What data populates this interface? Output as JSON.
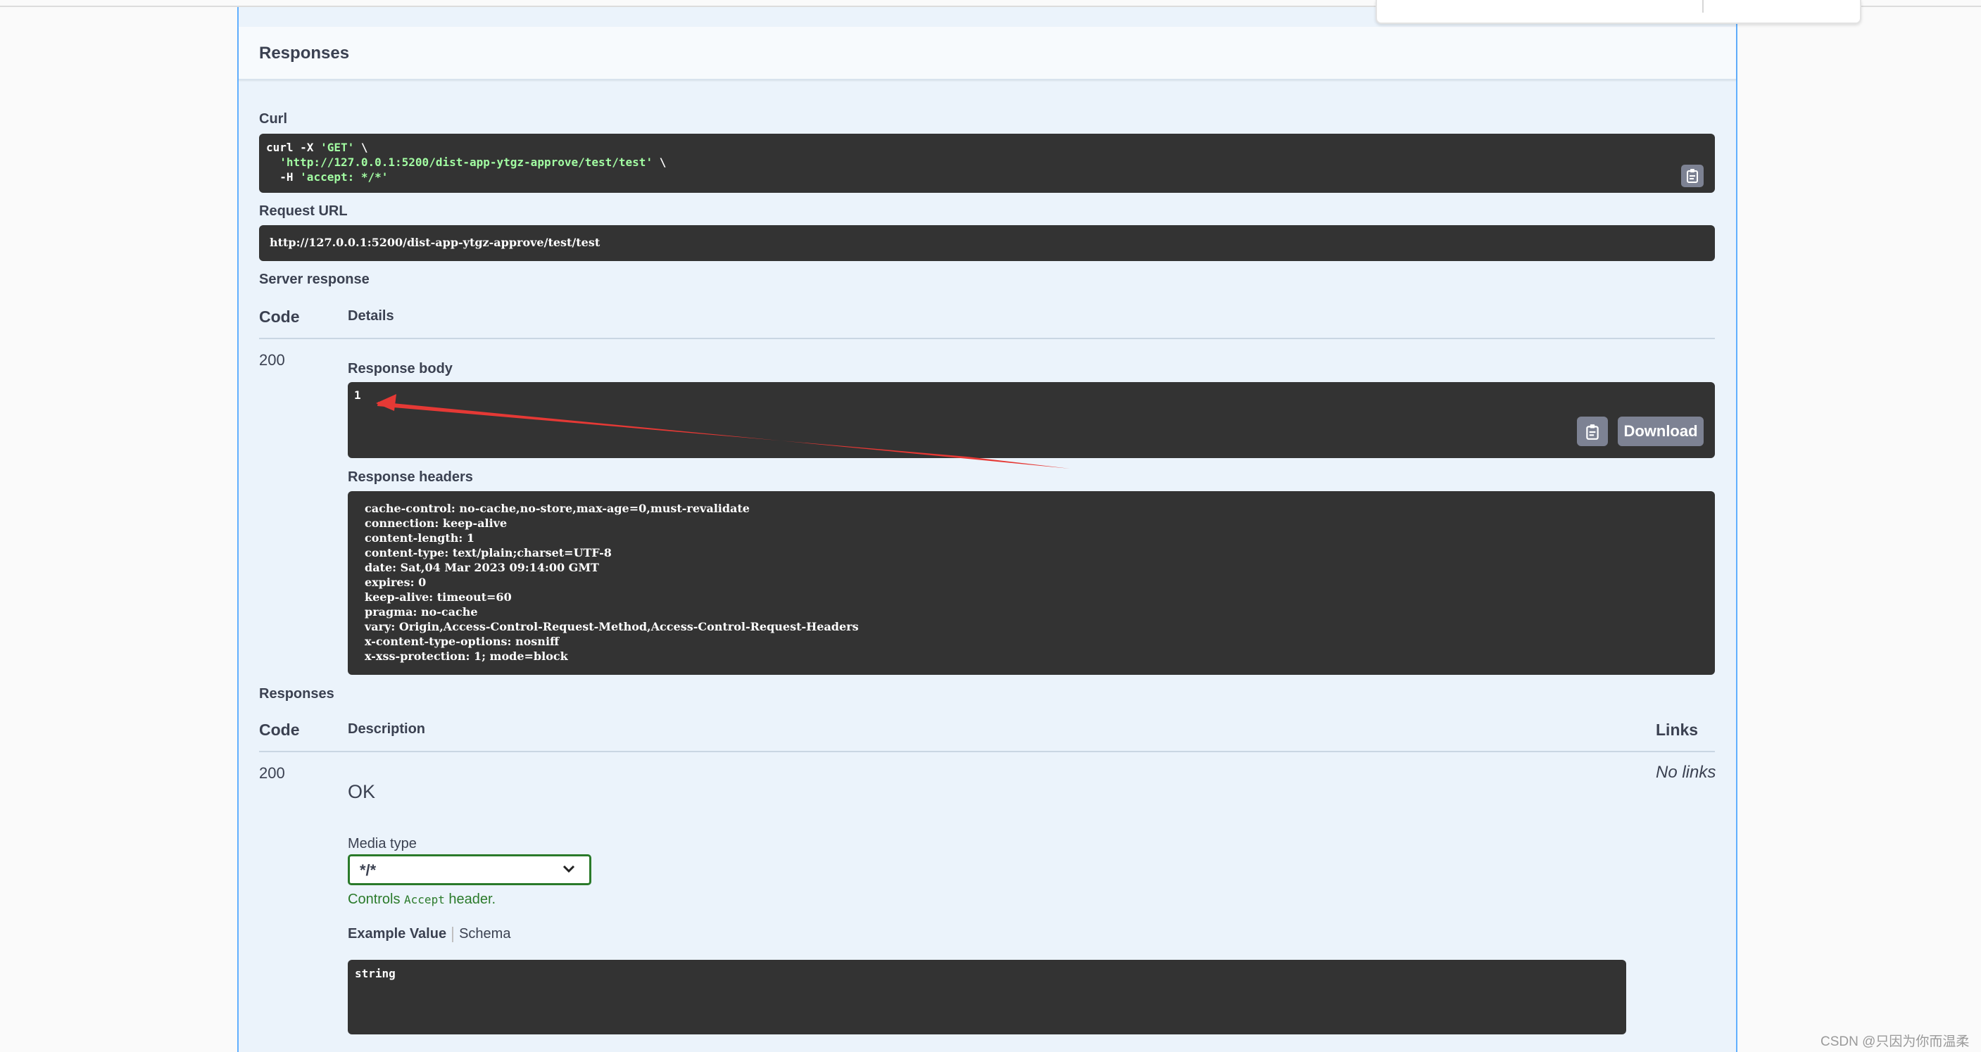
{
  "responses_header": "Responses",
  "curl": {
    "label": "Curl",
    "line1_cmd": "curl -X ",
    "line1_str": "'GET'",
    "line1_tail": " \\",
    "line2_str": "'http://127.0.0.1:5200/dist-app-ytgz-approve/test/test'",
    "line2_tail": " \\",
    "line3_cmd": "  -H ",
    "line3_str": "'accept: */*'"
  },
  "request_url": {
    "label": "Request URL",
    "value": "http://127.0.0.1:5200/dist-app-ytgz-approve/test/test"
  },
  "server_response": {
    "label": "Server response",
    "col_code": "Code",
    "col_details": "Details",
    "code": "200",
    "body_label": "Response body",
    "body": "1",
    "download_label": "Download",
    "headers_label": "Response headers",
    "headers": [
      "cache-control: no-cache,no-store,max-age=0,must-revalidate",
      "connection: keep-alive",
      "content-length: 1",
      "content-type: text/plain;charset=UTF-8",
      "date: Sat,04 Mar 2023 09:14:00 GMT",
      "expires: 0",
      "keep-alive: timeout=60",
      "pragma: no-cache",
      "vary: Origin,Access-Control-Request-Method,Access-Control-Request-Headers",
      "x-content-type-options: nosniff",
      "x-xss-protection: 1; mode=block"
    ]
  },
  "responses": {
    "label": "Responses",
    "col_code": "Code",
    "col_description": "Description",
    "col_links": "Links",
    "code": "200",
    "description": "OK",
    "links": "No links",
    "media_type_label": "Media type",
    "media_type_value": "*/*",
    "controls_prefix": "Controls ",
    "controls_code": "Accept",
    "controls_suffix": " header.",
    "tab_example": "Example Value",
    "tab_schema": "Schema",
    "example": "string"
  },
  "watermark": "CSDN @只因为你而温柔",
  "colors": {
    "get_blue": "#61affe",
    "panel_bg": "#ebf3fb",
    "code_bg": "#333333",
    "string_green": "#a2fca2",
    "select_border": "#2a7a2a",
    "annotation_red": "#e53935"
  },
  "icons": [
    "copy-icon",
    "chevron-down-icon",
    "red-arrow-annotation"
  ]
}
